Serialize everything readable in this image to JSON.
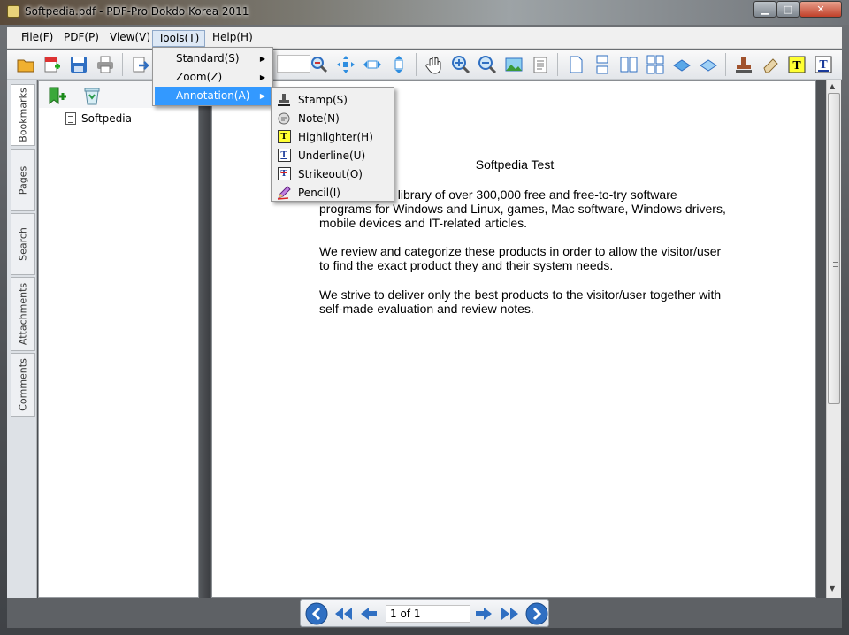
{
  "window": {
    "title": "Softpedia.pdf - PDF-Pro Dokdo Korea 2011",
    "minimize": "▁",
    "maximize": "□",
    "close": "✕"
  },
  "menubar": {
    "file": "File(F)",
    "pdf": "PDF(P)",
    "view": "View(V)",
    "tools": "Tools(T)",
    "help": "Help(H)"
  },
  "tools_menu": {
    "standard": "Standard(S)",
    "zoom": "Zoom(Z)",
    "annotation": "Annotation(A)",
    "submenu_arrow": "▶"
  },
  "annotation_menu": {
    "stamp": "Stamp(S)",
    "note": "Note(N)",
    "highlighter": "Highlighter(H)",
    "underline": "Underline(U)",
    "strikeout": "Strikeout(O)",
    "pencil": "Pencil(I)",
    "highlighter_glyph": "T",
    "underline_glyph": "T",
    "strikeout_glyph": "T"
  },
  "side_tabs": {
    "bookmarks": "Bookmarks",
    "pages": "Pages",
    "search": "Search",
    "attachments": "Attachments",
    "comments": "Comments"
  },
  "bookmarks": {
    "items": [
      {
        "label": "Softpedia"
      }
    ]
  },
  "document": {
    "title": "Softpedia Test",
    "paragraphs": [
      "Softpedia is a library of over 300,000 free and free-to-try software programs for Windows and Linux, games, Mac software, Windows drivers, mobile devices and IT-related articles.",
      "We review and categorize these products in order to allow the visitor/user to find the exact product they and their system needs.",
      "We strive to deliver only the best products to the visitor/user together with self-made evaluation and review notes."
    ]
  },
  "navigation": {
    "page_indicator": "1 of 1"
  },
  "colors": {
    "menu_highlight": "#3399ff",
    "nav_blue": "#2f6fc2"
  }
}
